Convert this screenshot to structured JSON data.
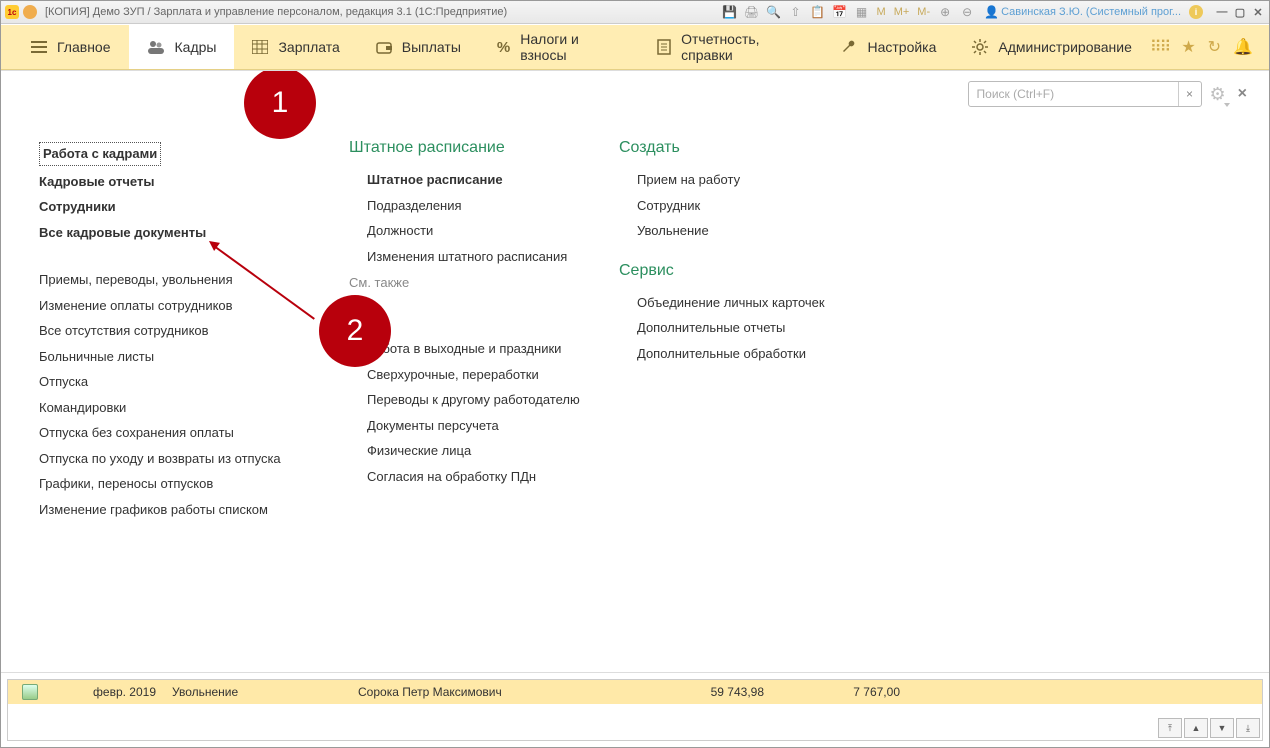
{
  "title": "[КОПИЯ] Демо ЗУП / Зарплата и управление персоналом, редакция 3.1  (1С:Предприятие)",
  "titlebar_icons": {
    "m": "M",
    "mplus": "M+",
    "mminus": "M-"
  },
  "user_name": "Савинская З.Ю. (Системный прог...",
  "menubar": [
    {
      "icon": "menu",
      "label": "Главное"
    },
    {
      "icon": "people",
      "label": "Кадры"
    },
    {
      "icon": "calc",
      "label": "Зарплата"
    },
    {
      "icon": "wallet",
      "label": "Выплаты"
    },
    {
      "icon": "percent",
      "label": "Налоги и взносы"
    },
    {
      "icon": "report",
      "label": "Отчетность, справки"
    },
    {
      "icon": "wrench",
      "label": "Настройка"
    },
    {
      "icon": "gear",
      "label": "Администрирование"
    }
  ],
  "search_placeholder": "Поиск (Ctrl+F)",
  "col1": {
    "items_top": [
      {
        "text": "Работа с кадрами",
        "framed": true
      },
      {
        "text": "Кадровые отчеты",
        "bold": true
      },
      {
        "text": "Сотрудники",
        "bold": true
      },
      {
        "text": "Все кадровые документы",
        "bold": true
      }
    ],
    "items_mid": [
      "Приемы, переводы, увольнения",
      "Изменение оплаты сотрудников",
      "Все отсутствия сотрудников",
      "Больничные листы",
      "Отпуска",
      "Командировки",
      "Отпуска без сохранения оплаты",
      "Отпуска по уходу и возвраты из отпуска",
      "Графики, переносы отпусков",
      "Изменение графиков работы списком"
    ]
  },
  "col2": {
    "head": "Штатное расписание",
    "items": [
      {
        "text": "Штатное расписание",
        "bold": true
      },
      {
        "text": "Подразделения"
      },
      {
        "text": "Должности"
      },
      {
        "text": "Изменения штатного расписания"
      }
    ],
    "see_also": "См. также",
    "see_also_items": [
      "Работа в выходные и праздники",
      "Сверхурочные, переработки",
      "Переводы к другому работодателю",
      "Документы персучета",
      "Физические лица",
      "Согласия на обработку ПДн"
    ]
  },
  "col3": {
    "create_head": "Создать",
    "create_items": [
      "Прием на работу",
      "Сотрудник",
      "Увольнение"
    ],
    "service_head": "Сервис",
    "service_items": [
      "Объединение личных карточек",
      "Дополнительные отчеты",
      "Дополнительные обработки"
    ]
  },
  "callouts": {
    "one": "1",
    "two": "2"
  },
  "grid": {
    "date": "февр. 2019",
    "type": "Увольнение",
    "name": "Сорока Петр Максимович",
    "n1": "59 743,98",
    "n2": "7 767,00"
  }
}
